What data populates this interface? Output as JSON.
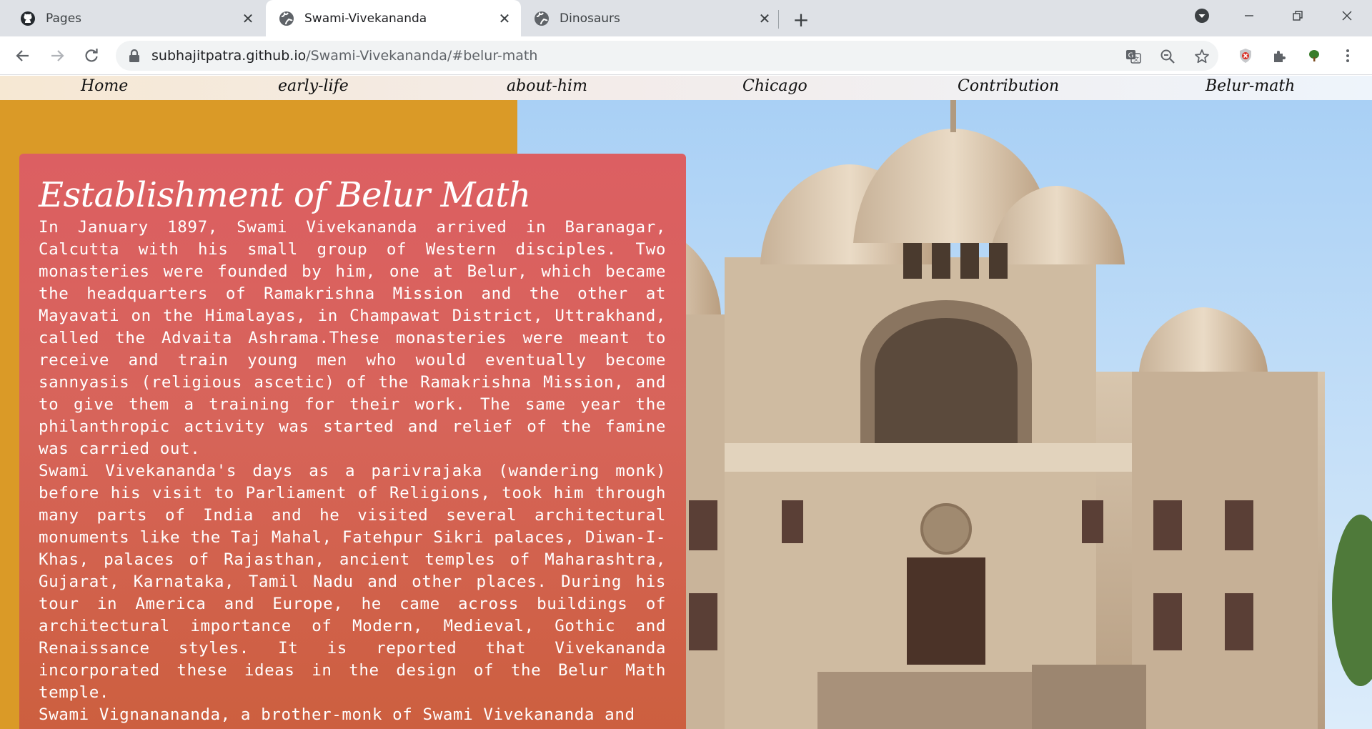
{
  "browser": {
    "tabs": [
      {
        "title": "Pages",
        "icon": "github-icon"
      },
      {
        "title": "Swami-Vivekananda",
        "icon": "globe-icon"
      },
      {
        "title": "Dinosaurs",
        "icon": "globe-icon"
      }
    ],
    "url_host": "subhajitpatra.github.io",
    "url_path": "/Swami-Vivekananda/#belur-math"
  },
  "nav": {
    "home": "Home",
    "early_life": "early-life",
    "about_him": "about-him",
    "chicago": "Chicago",
    "contribution": "Contribution",
    "belur_math": "Belur-math"
  },
  "content": {
    "heading": "Establishment of Belur Math",
    "p1": "In January 1897, Swami Vivekananda arrived in Baranagar, Calcutta with his small group of Western disciples. Two monasteries were founded by him, one at Belur, which became the headquarters of Ramakrishna Mission and the other at Mayavati on the Himalayas, in Champawat District, Uttrakhand, called the Advaita Ashrama.These monasteries were meant to receive and train young men who would eventually become sannyasis (religious ascetic) of the Ramakrishna Mission, and to give them a training for their work. The same year the philanthropic activity was started and relief of the famine was carried out.",
    "p2": "Swami Vivekananda's days as a parivrajaka (wandering monk) before his visit to Parliament of Religions, took him through many parts of India and he visited several architectural monuments like the Taj Mahal, Fatehpur Sikri palaces, Diwan-I-Khas, palaces of Rajasthan, ancient temples of Maharashtra, Gujarat, Karnataka, Tamil Nadu and other places. During his tour in America and Europe, he came across buildings of architectural importance of Modern, Medieval, Gothic and Renaissance styles. It is reported that Vivekananda incorporated these ideas in the design of the Belur Math temple.",
    "p3": "Swami Vignanananda, a brother-monk of Swami Vivekananda and"
  }
}
